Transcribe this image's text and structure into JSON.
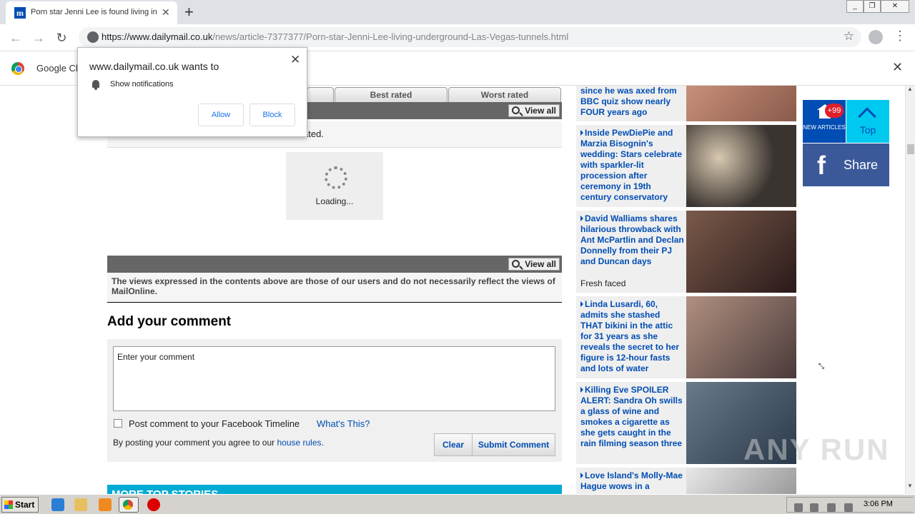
{
  "browser": {
    "tab_title": "Porn star Jenni Lee is found living in",
    "tab_favicon": "m",
    "url_host": "https://www.dailymail.co.uk",
    "url_path": "/news/article-7377377/Porn-star-Jenni-Lee-living-underground-Las-Vegas-tunnels.html",
    "infobar_text": "Google Ch"
  },
  "popup": {
    "title": "www.dailymail.co.uk wants to",
    "message": "Show notifications",
    "allow_label": "Allow",
    "block_label": "Block"
  },
  "comments": {
    "tabs": [
      "Best rated",
      "Worst rated"
    ],
    "view_all_label": "View all",
    "partial_text": "ated.",
    "loading_label": "Loading...",
    "disclaimer": "The views expressed in the contents above are those of our users and do not necessarily reflect the views of MailOnline.",
    "add_title": "Add your comment",
    "input_placeholder": "Enter your comment",
    "fb_label": "Post comment to your Facebook Timeline",
    "whats_this": "What's This?",
    "agree_prefix": "By posting your comment you agree to our",
    "house_rules": "house rules",
    "agree_suffix": ".",
    "clear_label": "Clear",
    "submit_label": "Submit Comment",
    "more_stories": "MORE TOP STORIES"
  },
  "stories": [
    {
      "headline": "since he was axed from BBC quiz show nearly FOUR years ago",
      "sub": "",
      "color": "#c8907a"
    },
    {
      "headline": "Inside PewDiePie and Marzia Bisognin's wedding: Stars celebrate with sparkler-lit procession after ceremony in 19th century conservatory",
      "sub": "",
      "color": "#3a3430"
    },
    {
      "headline": "David Walliams shares hilarious throwback with Ant McPartlin and Declan Donnelly from their PJ and Duncan days",
      "sub": "Fresh faced",
      "color": "#5a3a3a"
    },
    {
      "headline": "Linda Lusardi, 60, admits she stashed THAT bikini in the attic for 31 years as she reveals the secret to her figure is 12-hour fasts and lots of water",
      "sub": "",
      "color": "#8a6a5a"
    },
    {
      "headline": "Killing Eve SPOILER ALERT: Sandra Oh swills a glass of wine and smokes a cigarette as she gets caught in the rain filming season three",
      "sub": "",
      "color": "#4a5a6a"
    },
    {
      "headline": "Love Island's Molly-Mae Hague wows in a",
      "sub": "",
      "color": "#d8d8d8"
    }
  ],
  "widgets": {
    "badge": "+99",
    "new_articles": "NEW ARTICLES",
    "top_label": "Top",
    "share_label": "Share"
  },
  "taskbar": {
    "start_label": "Start",
    "clock": "3:06 PM"
  },
  "watermark": "ANY RUN"
}
